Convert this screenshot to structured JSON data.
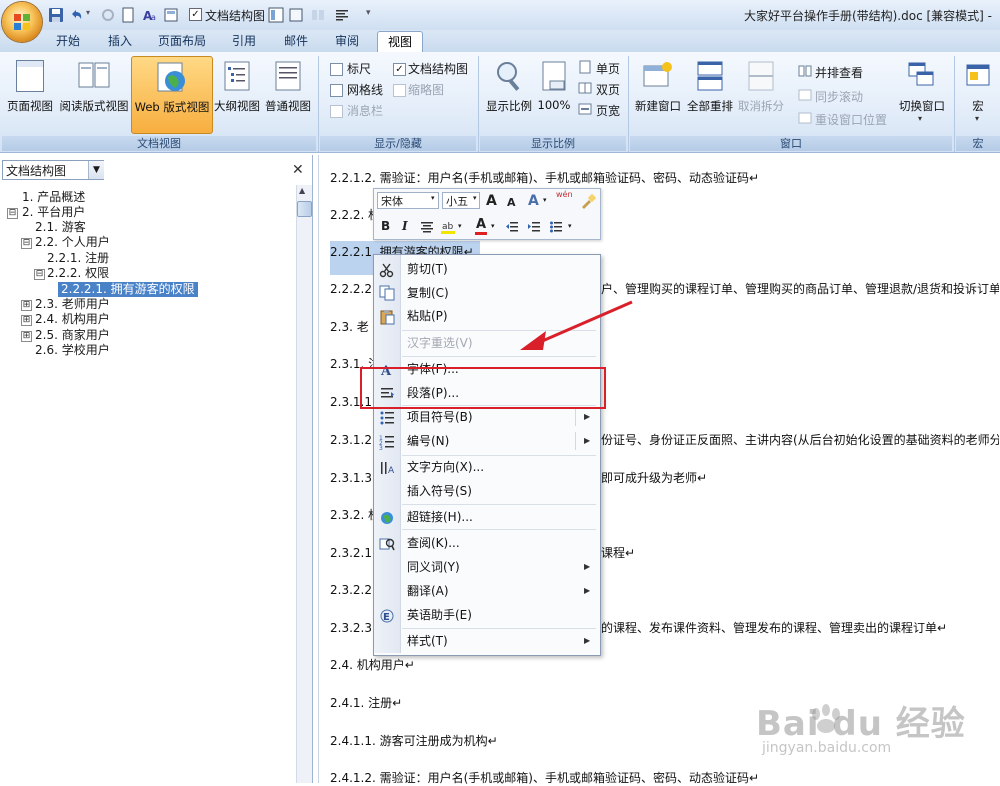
{
  "window": {
    "doc_title": "大家好平台操作手册(带结构).doc [兼容模式] -",
    "qat_checkbox_label": "文档结构图"
  },
  "tabs": [
    "开始",
    "插入",
    "页面布局",
    "引用",
    "邮件",
    "审阅",
    "视图"
  ],
  "ribbon": {
    "doc_views": {
      "label": "文档视图",
      "buttons": [
        "页面视图",
        "阅读版式视图",
        "Web 版式视图",
        "大纲视图",
        "普通视图"
      ]
    },
    "show_hide": {
      "label": "显示/隐藏",
      "items": [
        {
          "text": "标尺",
          "checked": false,
          "enabled": true
        },
        {
          "text": "文档结构图",
          "checked": true,
          "enabled": true
        },
        {
          "text": "网格线",
          "checked": false,
          "enabled": true
        },
        {
          "text": "缩略图",
          "checked": false,
          "enabled": false
        },
        {
          "text": "消息栏",
          "checked": false,
          "enabled": false
        }
      ]
    },
    "zoom": {
      "label": "显示比例",
      "zoom_button": "显示比例",
      "percent": "100%",
      "single": "单页",
      "double": "双页",
      "page_width": "页宽"
    },
    "window": {
      "label": "窗口",
      "new_window": "新建窗口",
      "arrange_all": "全部重排",
      "remove_split": "取消拆分",
      "side_by_side": "并排查看",
      "sync_scroll": "同步滚动",
      "reset_position": "重设窗口位置",
      "switch_window": "切换窗口"
    },
    "macro": {
      "label": "宏",
      "button": "宏"
    }
  },
  "nav_pane": {
    "header": "文档结构图",
    "items": [
      {
        "text": "1.  产品概述",
        "box": "",
        "selected": false
      },
      {
        "text": "2.  平台用户",
        "box": "⊟",
        "selected": false
      },
      {
        "text": "2.1.  游客",
        "box": "",
        "selected": false
      },
      {
        "text": "2.2.  个人用户",
        "box": "⊟",
        "selected": false
      },
      {
        "text": "2.2.1.  注册",
        "box": "",
        "selected": false
      },
      {
        "text": "2.2.2.  权限",
        "box": "⊟",
        "selected": false
      },
      {
        "text": "2.2.2.1.  拥有游客的权限",
        "box": "",
        "selected": true
      },
      {
        "text": "2.3.  老师用户",
        "box": "⊞",
        "selected": false
      },
      {
        "text": "2.4.  机构用户",
        "box": "⊞",
        "selected": false
      },
      {
        "text": "2.5.  商家用户",
        "box": "⊞",
        "selected": false
      },
      {
        "text": "2.6.  学校用户",
        "box": "",
        "selected": false
      }
    ]
  },
  "document": {
    "paragraphs": [
      "2.2.1.2.  需验证：用户名(手机或邮箱)、手机或邮箱验证码、密码、动态验证码↵",
      "2.2.2.  权",
      "2.2.2.1.  拥有游客的权限↵",
      "2.2.2.2.  ",
      "2.3.  老",
      "2.3.1.  注",
      "2.3.1.1.",
      "2.3.1.2.",
      "2.3.1.3.",
      "2.3.2.  权",
      "2.3.2.1.",
      "2.3.2.2.",
      "2.3.2.3.",
      "2.4.  机构用户↵",
      "2.4.1.  注册↵",
      "2.4.1.1.  游客可注册成为机构↵",
      "2.4.1.2.  需验证：用户名(手机或邮箱)、手机或邮箱验证码、密码、动态验证码↵"
    ],
    "right_fragments": [
      "户、管理购买的课程订单、管理购买的商品订单、管理退款/退货和投诉订单。↵",
      "份证号、身份证正反面照、主讲内容(从后台初始化设置的基础资料的老师分类",
      "即可成升级为老师↵",
      "课程↵",
      "的课程、发布课件资料、管理发布的课程、管理卖出的课程订单↵"
    ]
  },
  "mini_toolbar": {
    "font": "宋体",
    "size": "小五",
    "grow": "A",
    "shrink": "A",
    "bold": "B",
    "italic": "I",
    "font_color": "A",
    "wen": "wén"
  },
  "context_menu": {
    "items": [
      {
        "label": "剪切(T)",
        "icon": "scissors-icon",
        "enabled": true,
        "submenu": false
      },
      {
        "label": "复制(C)",
        "icon": "copy-icon",
        "enabled": true,
        "submenu": false
      },
      {
        "label": "粘贴(P)",
        "icon": "paste-icon",
        "enabled": true,
        "submenu": false
      },
      {
        "label": "汉字重选(V)",
        "icon": "",
        "enabled": false,
        "submenu": false
      },
      {
        "label": "字体(F)...",
        "icon": "font-icon",
        "enabled": true,
        "submenu": false
      },
      {
        "label": "段落(P)...",
        "icon": "paragraph-icon",
        "enabled": true,
        "submenu": false
      },
      {
        "label": "项目符号(B)",
        "icon": "bullets-icon",
        "enabled": true,
        "submenu": true
      },
      {
        "label": "编号(N)",
        "icon": "numbering-icon",
        "enabled": true,
        "submenu": true
      },
      {
        "label": "文字方向(X)...",
        "icon": "text-direction-icon",
        "enabled": true,
        "submenu": false
      },
      {
        "label": "插入符号(S)",
        "icon": "",
        "enabled": true,
        "submenu": false
      },
      {
        "label": "超链接(H)...",
        "icon": "hyperlink-icon",
        "enabled": true,
        "submenu": false
      },
      {
        "label": "查阅(K)...",
        "icon": "lookup-icon",
        "enabled": true,
        "submenu": false
      },
      {
        "label": "同义词(Y)",
        "icon": "",
        "enabled": true,
        "submenu": true
      },
      {
        "label": "翻译(A)",
        "icon": "",
        "enabled": true,
        "submenu": true
      },
      {
        "label": "英语助手(E)",
        "icon": "english-assistant-icon",
        "enabled": true,
        "submenu": false
      },
      {
        "label": "样式(T)",
        "icon": "",
        "enabled": true,
        "submenu": true
      }
    ]
  },
  "watermark": {
    "brand": "Bai du 经验",
    "url": "jingyan.baidu.com"
  },
  "colors": {
    "annotation_red": "#d9202a",
    "selection": "#bcd3ef",
    "ribbon_active": "#f7ae3f"
  }
}
